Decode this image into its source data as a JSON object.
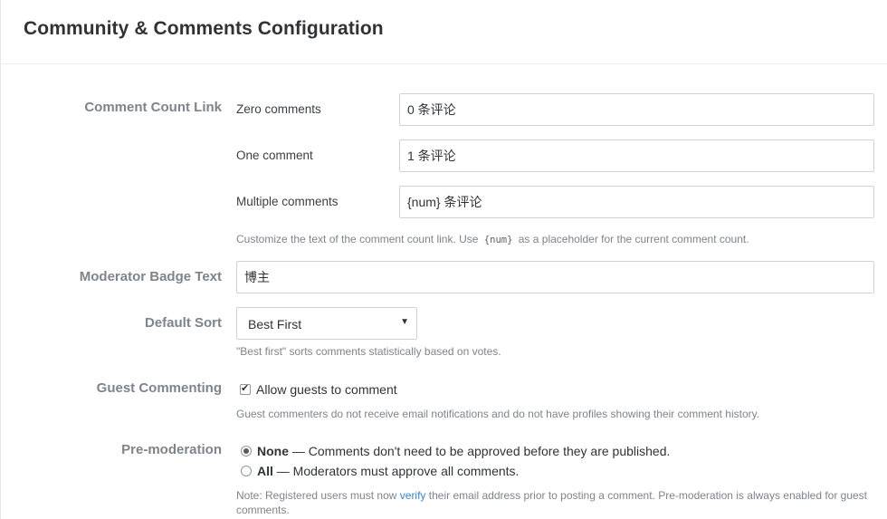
{
  "page": {
    "title": "Community & Comments Configuration"
  },
  "comment_count_link": {
    "label": "Comment Count Link",
    "zero": {
      "label": "Zero comments",
      "value": "0 条评论"
    },
    "one": {
      "label": "One comment",
      "value": "1 条评论"
    },
    "multiple": {
      "label": "Multiple comments",
      "value": "{num} 条评论"
    },
    "help_before": "Customize the text of the comment count link. Use",
    "help_code": "{num}",
    "help_after": "as a placeholder for the current comment count."
  },
  "moderator_badge": {
    "label": "Moderator Badge Text",
    "value": "博主"
  },
  "default_sort": {
    "label": "Default Sort",
    "selected": "Best First",
    "help": "\"Best first\" sorts comments statistically based on votes."
  },
  "guest_commenting": {
    "label": "Guest Commenting",
    "checkbox_label": "Allow guests to comment",
    "checked": true,
    "help": "Guest commenters do not receive email notifications and do not have profiles showing their comment history."
  },
  "premoderation": {
    "label": "Pre-moderation",
    "options": [
      {
        "title": "None",
        "desc": "— Comments don't need to be approved before they are published.",
        "selected": true
      },
      {
        "title": "All",
        "desc": "— Moderators must approve all comments.",
        "selected": false
      }
    ],
    "note_before": "Note: Registered users must now",
    "note_link": "verify",
    "note_after": "their email address prior to posting a comment. Pre-moderation is always enabled for guest comments."
  }
}
